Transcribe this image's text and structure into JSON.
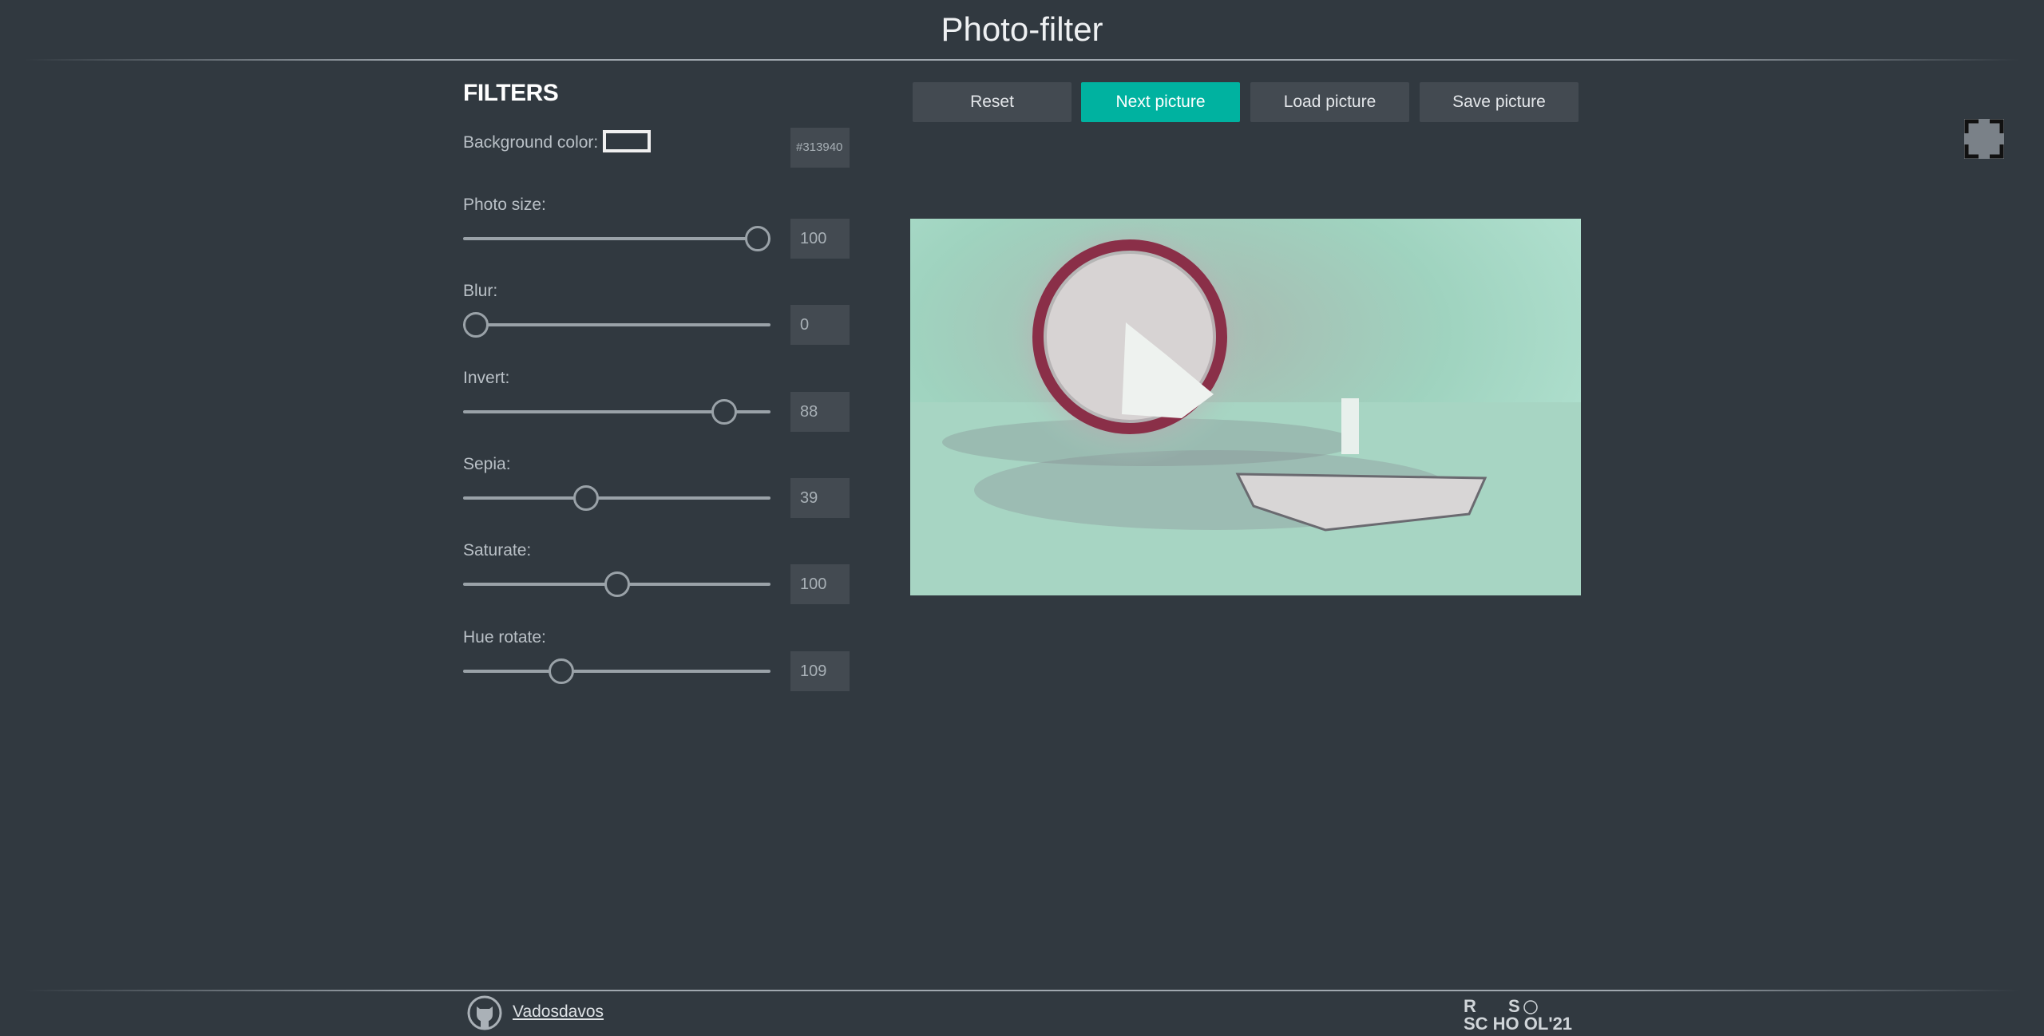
{
  "header": {
    "title": "Photo-filter"
  },
  "filters": {
    "title": "FILTERS",
    "background": {
      "label": "Background color:",
      "value": "#313940"
    },
    "sliders": [
      {
        "label": "Photo size:",
        "value": "100",
        "min": 0,
        "max": 100
      },
      {
        "label": "Blur:",
        "value": "0",
        "min": 0,
        "max": 10
      },
      {
        "label": "Invert:",
        "value": "88",
        "min": 0,
        "max": 100
      },
      {
        "label": "Sepia:",
        "value": "39",
        "min": 0,
        "max": 100
      },
      {
        "label": "Saturate:",
        "value": "100",
        "min": 0,
        "max": 200
      },
      {
        "label": "Hue rotate:",
        "value": "109",
        "min": 0,
        "max": 360
      }
    ]
  },
  "toolbar": {
    "reset": "Reset",
    "next": "Next picture",
    "load": "Load picture",
    "save": "Save picture"
  },
  "colors": {
    "accent": "#00b2a0",
    "background": "#313940",
    "button": "#434a51"
  },
  "footer": {
    "author": "Vadosdavos",
    "logo_text": "RS SCHOOL '21"
  }
}
